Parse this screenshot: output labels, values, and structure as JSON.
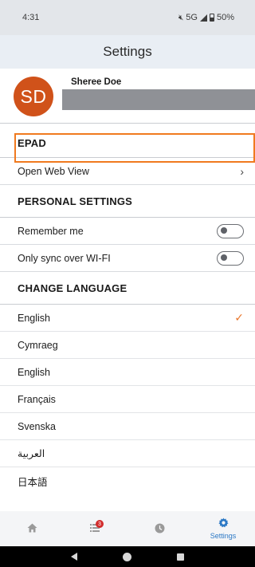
{
  "status_bar": {
    "time": "4:31",
    "network": "5G",
    "battery": "50%"
  },
  "app_bar": {
    "title": "Settings"
  },
  "profile": {
    "initials": "SD",
    "name": "Sheree Doe",
    "avatar_color": "#d0521a"
  },
  "sections": {
    "epad": {
      "title": "EPAD",
      "items": [
        {
          "label": "Open Web View"
        }
      ]
    },
    "personal": {
      "title": "PERSONAL SETTINGS",
      "items": [
        {
          "label": "Remember me",
          "checked": false
        },
        {
          "label": "Only sync over WI-FI",
          "checked": false
        }
      ]
    },
    "language": {
      "title": "CHANGE LANGUAGE",
      "items": [
        {
          "label": "English",
          "selected": true
        },
        {
          "label": "Cymraeg",
          "selected": false
        },
        {
          "label": "English",
          "selected": false
        },
        {
          "label": "Français",
          "selected": false
        },
        {
          "label": "Svenska",
          "selected": false
        },
        {
          "label": "العربية",
          "selected": false
        },
        {
          "label": "日本語",
          "selected": false
        }
      ]
    }
  },
  "bottom_nav": {
    "items": [
      {
        "icon": "home-icon",
        "label": ""
      },
      {
        "icon": "list-icon",
        "label": "",
        "badge": "3"
      },
      {
        "icon": "clock-icon",
        "label": ""
      },
      {
        "icon": "gear-icon",
        "label": "Settings",
        "active": true
      }
    ]
  },
  "colors": {
    "accent": "#2b78c5",
    "highlight": "#f07a1f",
    "check": "#e9762b"
  }
}
